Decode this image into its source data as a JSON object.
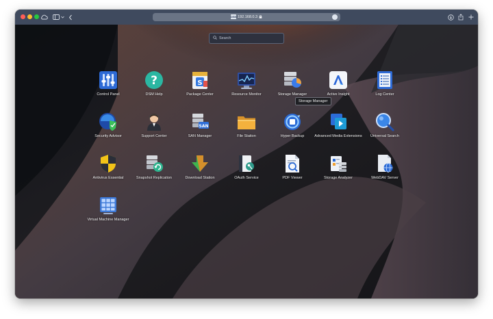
{
  "browser": {
    "url": "192.168.0.3",
    "address_badge": "DSM"
  },
  "search": {
    "placeholder": "Search"
  },
  "tooltip": "Storage Manager",
  "apps": [
    {
      "label": "Control Panel",
      "icon": "control-panel-icon"
    },
    {
      "label": "DSM Help",
      "icon": "help-icon"
    },
    {
      "label": "Package Center",
      "icon": "package-center-icon"
    },
    {
      "label": "Resource Monitor",
      "icon": "resource-monitor-icon"
    },
    {
      "label": "Storage Manager",
      "icon": "storage-manager-icon"
    },
    {
      "label": "Active Insight",
      "icon": "active-insight-icon"
    },
    {
      "label": "Log Center",
      "icon": "log-center-icon"
    },
    {
      "label": "Security Advisor",
      "icon": "security-advisor-icon"
    },
    {
      "label": "Support Center",
      "icon": "support-center-icon"
    },
    {
      "label": "SAN Manager",
      "icon": "san-manager-icon"
    },
    {
      "label": "File Station",
      "icon": "file-station-icon"
    },
    {
      "label": "Hyper Backup",
      "icon": "hyper-backup-icon"
    },
    {
      "label": "Advanced Media Extensions",
      "icon": "advanced-media-extensions-icon"
    },
    {
      "label": "Universal Search",
      "icon": "universal-search-icon"
    },
    {
      "label": "Antivirus Essential",
      "icon": "antivirus-icon"
    },
    {
      "label": "Snapshot Replication",
      "icon": "snapshot-replication-icon"
    },
    {
      "label": "Download Station",
      "icon": "download-station-icon"
    },
    {
      "label": "OAuth Service",
      "icon": "oauth-service-icon"
    },
    {
      "label": "PDF Viewer",
      "icon": "pdf-viewer-icon"
    },
    {
      "label": "Storage Analyzer",
      "icon": "storage-analyzer-icon"
    },
    {
      "label": "WebDAV Server",
      "icon": "webdav-server-icon"
    },
    {
      "label": "Virtual Machine Manager",
      "icon": "virtual-machine-manager-icon"
    }
  ]
}
